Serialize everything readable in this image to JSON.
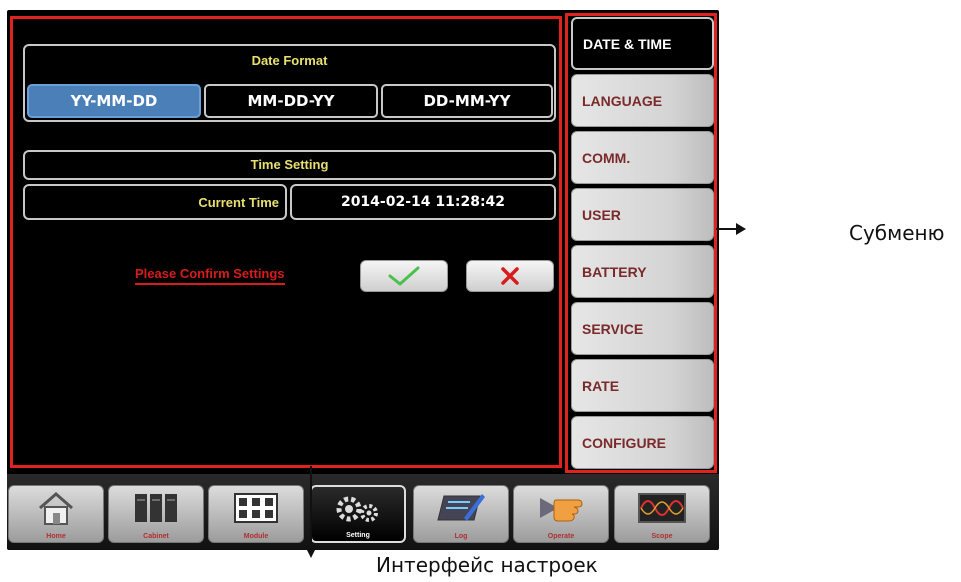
{
  "date_format": {
    "title": "Date Format",
    "options": [
      "YY-MM-DD",
      "MM-DD-YY",
      "DD-MM-YY"
    ],
    "selected": "YY-MM-DD"
  },
  "time_setting": {
    "title": "Time Setting",
    "label": "Current Time",
    "value": "2014-02-14 11:28:42"
  },
  "confirm": {
    "text": "Please Confirm Settings",
    "ok_icon": "checkmark-icon",
    "cancel_icon": "cross-icon"
  },
  "submenu": {
    "items": [
      "DATE & TIME",
      "LANGUAGE",
      "COMM.",
      "USER",
      "BATTERY",
      "SERVICE",
      "RATE",
      "CONFIGURE"
    ],
    "selected": "DATE & TIME"
  },
  "navbar": {
    "items": [
      {
        "label": "Home",
        "icon": "home-icon"
      },
      {
        "label": "Cabinet",
        "icon": "cabinet-icon"
      },
      {
        "label": "Module",
        "icon": "module-icon"
      },
      {
        "label": "Setting",
        "icon": "gear-icon"
      },
      {
        "label": "Log",
        "icon": "log-icon"
      },
      {
        "label": "Operate",
        "icon": "hand-icon"
      },
      {
        "label": "Scope",
        "icon": "scope-icon"
      }
    ],
    "selected": "Setting"
  },
  "annotations": {
    "submenu_caption": "Субменю",
    "settings_caption": "Интерфейс настроек"
  },
  "colors": {
    "highlight_frame": "#e0231f",
    "title_text": "#e8e070",
    "selected_option": "#4a7fb8",
    "confirm_text": "#d81c1c"
  }
}
